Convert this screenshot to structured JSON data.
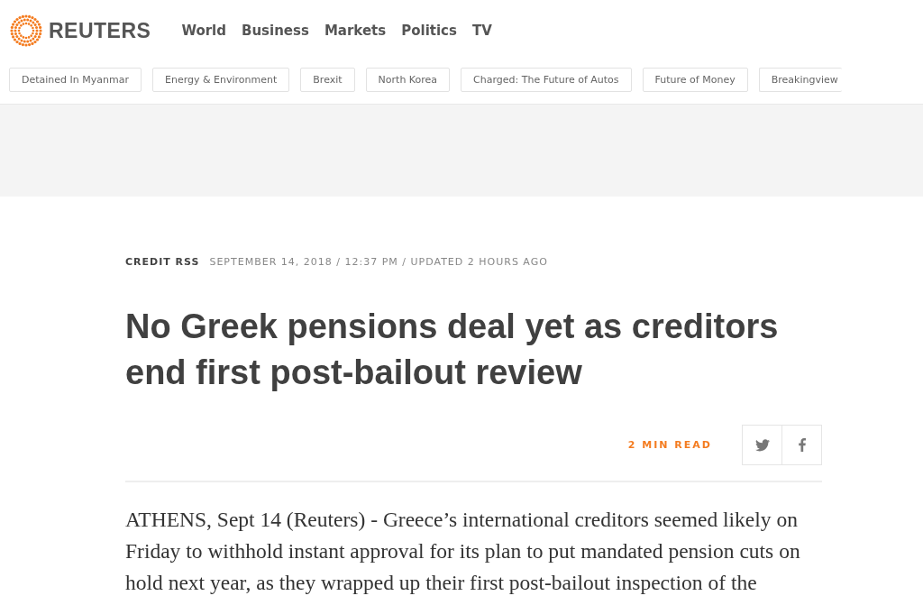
{
  "header": {
    "logo": "REUTERS",
    "nav": [
      "World",
      "Business",
      "Markets",
      "Politics",
      "TV"
    ]
  },
  "topics": [
    "Detained In Myanmar",
    "Energy & Environment",
    "Brexit",
    "North Korea",
    "Charged: The Future of Autos",
    "Future of Money",
    "Breakingview"
  ],
  "article": {
    "section": "CREDIT RSS",
    "dateline": "SEPTEMBER 14, 2018 / 12:37 PM / UPDATED 2 HOURS AGO",
    "headline": "No Greek pensions deal yet as creditors end first post-bailout review",
    "read_time": "2 MIN READ",
    "share": [
      {
        "kind": "twitter"
      },
      {
        "kind": "facebook"
      }
    ],
    "body_lines": [
      "ATHENS, Sept 14 (Reuters) - Greece’s international creditors seemed likely on",
      "Friday to withhold instant approval for its plan to put mandated pension cuts on",
      "hold next year, as they wrapped up their first post-bailout inspection of the"
    ]
  }
}
